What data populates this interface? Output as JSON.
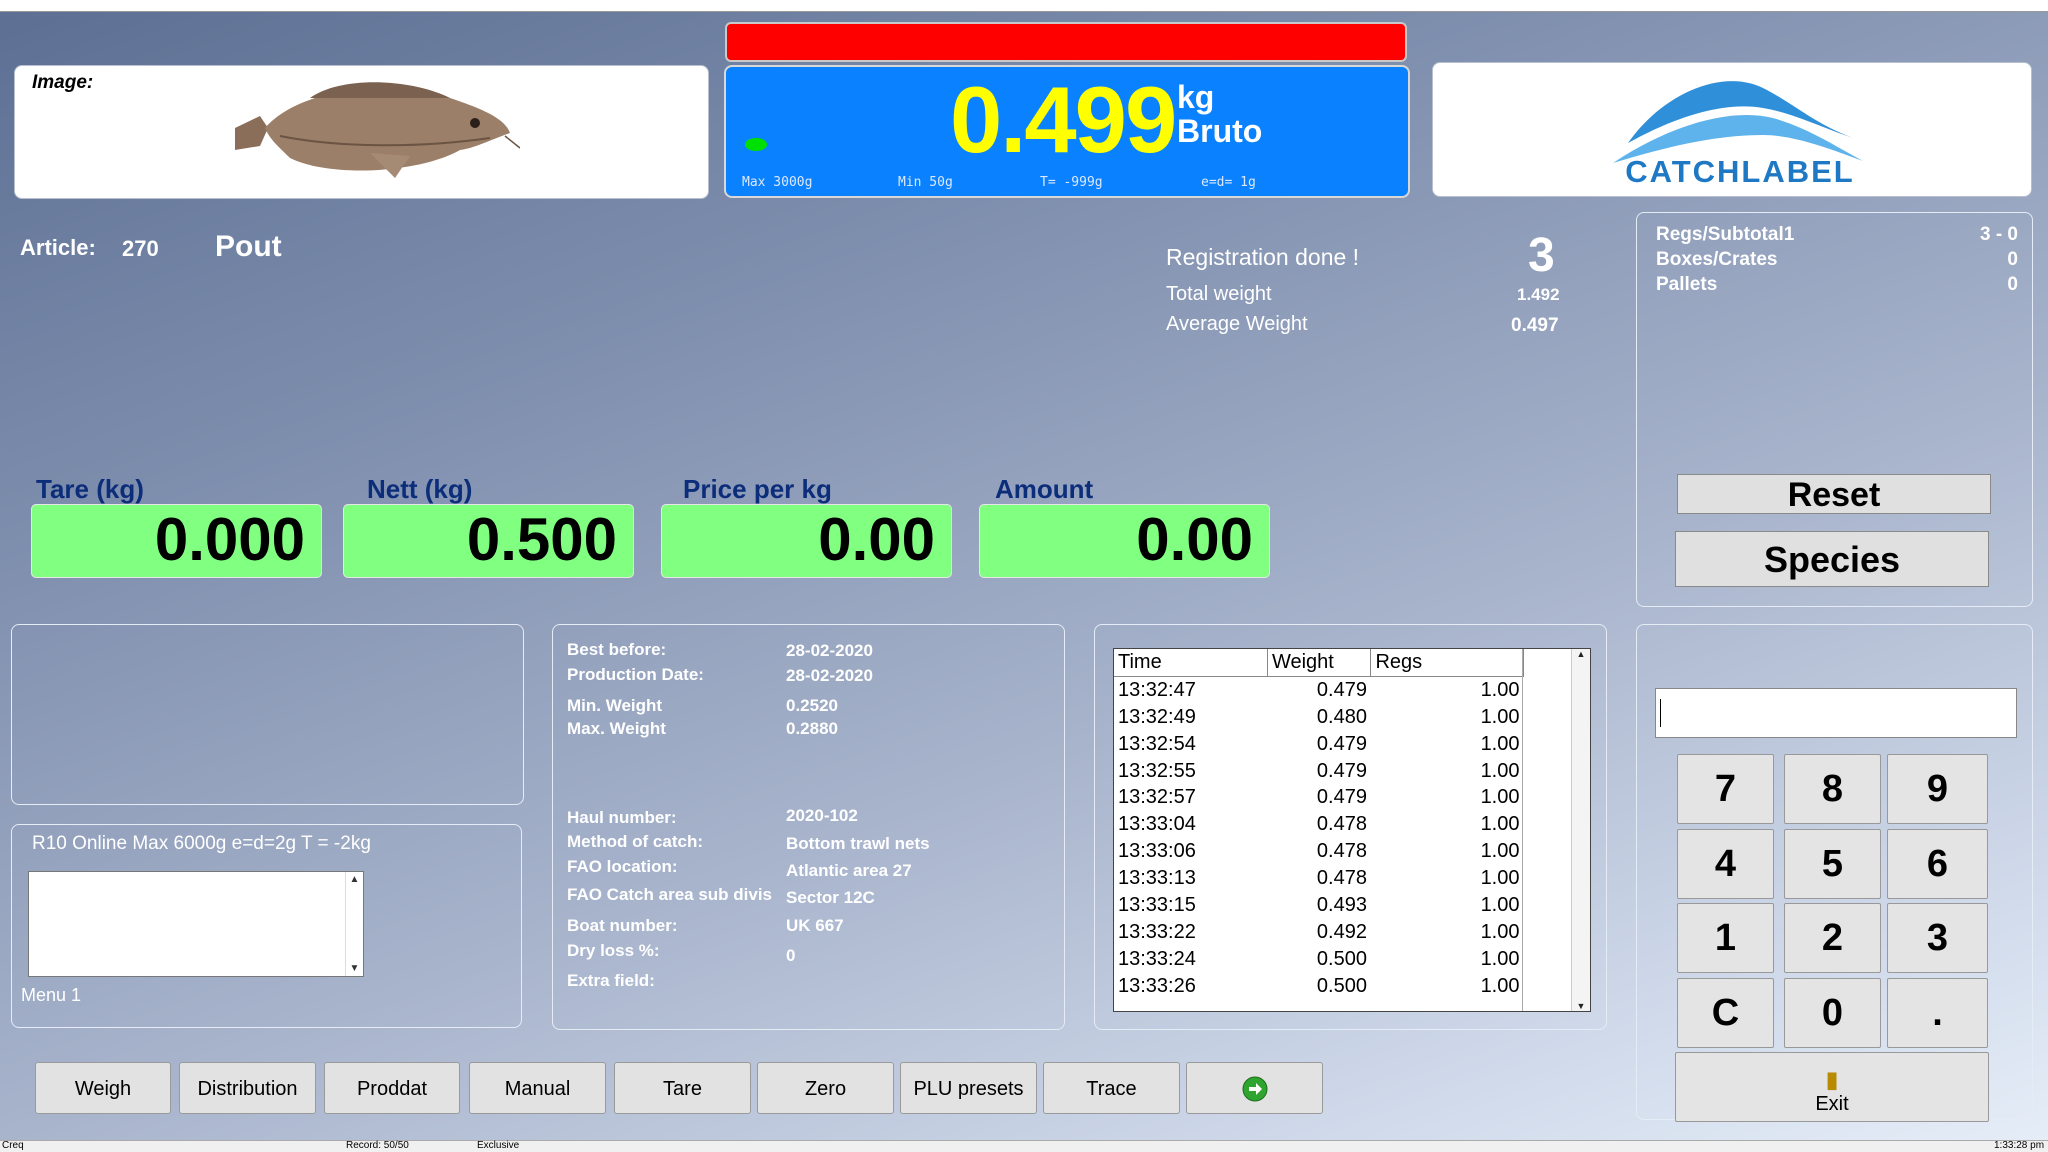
{
  "header": {
    "image_label": "Image:",
    "weight": "0.499",
    "unit": "kg",
    "mode": "Bruto",
    "max": "Max 3000g",
    "min": "Min  50g",
    "tare": "T= -999g",
    "ed": "e=d= 1g",
    "logo_text": "CATCHLABEL"
  },
  "article": {
    "label": "Article:",
    "number": "270",
    "name": "Pout"
  },
  "registration": {
    "status": "Registration done !",
    "count": "3",
    "total_label": "Total weight",
    "total_value": "1.492",
    "avg_label": "Average Weight",
    "avg_value": "0.497"
  },
  "subtotals": {
    "rows": [
      {
        "label": "Regs/Subtotal1",
        "value": "3 - 0"
      },
      {
        "label": "Boxes/Crates",
        "value": "0"
      },
      {
        "label": "Pallets",
        "value": "0"
      }
    ],
    "reset": "Reset",
    "species": "Species"
  },
  "fields": {
    "tare": {
      "label": "Tare (kg)",
      "value": "0.000"
    },
    "nett": {
      "label": "Nett (kg)",
      "value": "0.500"
    },
    "price": {
      "label": "Price per kg",
      "value": "0.00"
    },
    "amount": {
      "label": "Amount",
      "value": "0.00"
    }
  },
  "menu": {
    "device": "R10 Online Max 6000g e=d=2g T = -2kg",
    "label": "Menu 1"
  },
  "product_info": [
    {
      "label": "Best before:",
      "value": "28-02-2020"
    },
    {
      "label": "Production Date:",
      "value": "28-02-2020"
    },
    {
      "label": "Min. Weight",
      "value": "0.2520"
    },
    {
      "label": "Max. Weight",
      "value": "0.2880"
    },
    {
      "label": "Haul number:",
      "value": "2020-102"
    },
    {
      "label": "Method of catch:",
      "value": "Bottom trawl nets"
    },
    {
      "label": "FAO location:",
      "value": "Atlantic area 27"
    },
    {
      "label": "FAO Catch area sub divis",
      "value": "Sector 12C"
    },
    {
      "label": "Boat number:",
      "value": "UK 667"
    },
    {
      "label": "Dry loss %:",
      "value": "0"
    },
    {
      "label": "Extra field:",
      "value": ""
    }
  ],
  "log": {
    "columns": [
      "Time",
      "Weight",
      "Regs"
    ],
    "rows": [
      [
        "13:32:47",
        "0.479",
        "1.00"
      ],
      [
        "13:32:49",
        "0.480",
        "1.00"
      ],
      [
        "13:32:54",
        "0.479",
        "1.00"
      ],
      [
        "13:32:55",
        "0.479",
        "1.00"
      ],
      [
        "13:32:57",
        "0.479",
        "1.00"
      ],
      [
        "13:33:04",
        "0.478",
        "1.00"
      ],
      [
        "13:33:06",
        "0.478",
        "1.00"
      ],
      [
        "13:33:13",
        "0.478",
        "1.00"
      ],
      [
        "13:33:15",
        "0.493",
        "1.00"
      ],
      [
        "13:33:22",
        "0.492",
        "1.00"
      ],
      [
        "13:33:24",
        "0.500",
        "1.00"
      ],
      [
        "13:33:26",
        "0.500",
        "1.00"
      ]
    ]
  },
  "keypad": {
    "keys": [
      "7",
      "8",
      "9",
      "4",
      "5",
      "6",
      "1",
      "2",
      "3",
      "C",
      "0",
      "."
    ],
    "exit": "Exit"
  },
  "toolbar": [
    "Weigh",
    "Distribution",
    "Proddat",
    "Manual",
    "Tare",
    "Zero",
    "PLU presets",
    "Trace"
  ],
  "statusbar": {
    "left": "Creq",
    "record": "Record: 50/50",
    "mode": "Exclusive",
    "time": "1:33:28 pm"
  },
  "colors": {
    "scale_bg": "#0a82ff",
    "weight": "#ffff00",
    "field_bg": "#80ff80",
    "alarm": "#ff0000"
  }
}
